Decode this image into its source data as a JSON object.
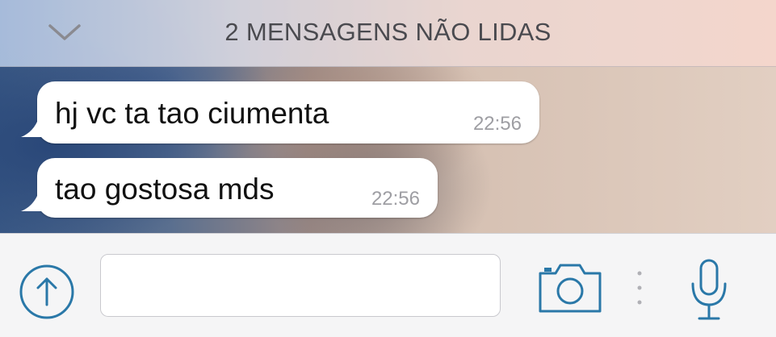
{
  "unread_banner": {
    "text": "2 MENSAGENS NÃO LIDAS",
    "icon": "chevron-down-icon"
  },
  "messages": [
    {
      "text": "hj vc ta tao ciumenta",
      "time": "22:56"
    },
    {
      "text": "tao gostosa mds",
      "time": "22:56"
    }
  ],
  "input_bar": {
    "attach_icon": "upload-arrow-icon",
    "message_value": "",
    "camera_icon": "camera-icon",
    "mic_icon": "microphone-icon"
  },
  "colors": {
    "accent": "#2a78a8",
    "bubble": "#ffffff",
    "timestamp": "#9e9ea3"
  }
}
